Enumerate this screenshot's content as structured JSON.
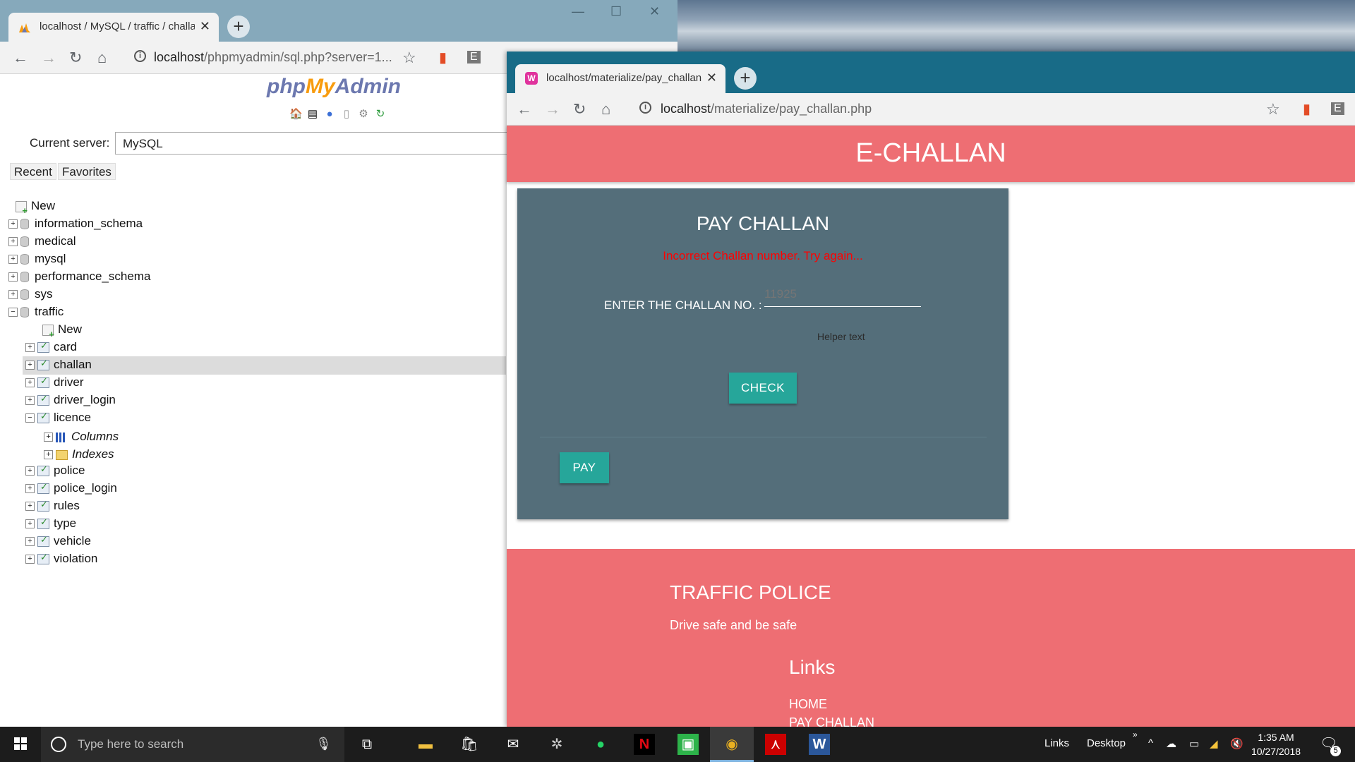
{
  "left_window": {
    "tab_title": "localhost / MySQL / traffic / challan",
    "url_host": "localhost",
    "url_path": "/phpmyadmin/sql.php?server=1...",
    "logo": {
      "php": "php",
      "my": "My",
      "admin": "Admin"
    },
    "current_server_label": "Current server:",
    "current_server_value": "MySQL",
    "recent_label": "Recent",
    "favorites_label": "Favorites",
    "tree": {
      "new": "New",
      "dbs": [
        "information_schema",
        "medical",
        "mysql",
        "performance_schema",
        "sys"
      ],
      "traffic": "traffic",
      "traffic_new": "New",
      "tables_a": [
        "card",
        "challan",
        "driver",
        "driver_login"
      ],
      "licence": "licence",
      "columns": "Columns",
      "indexes": "Indexes",
      "tables_b": [
        "police",
        "police_login",
        "rules",
        "type",
        "vehicle",
        "violation"
      ]
    }
  },
  "right_window": {
    "tab_title": "localhost/materialize/pay_challan.php",
    "url_host": "localhost",
    "url_path": "/materialize/pay_challan.php",
    "brand": "E-CHALLAN",
    "card": {
      "title": "PAY CHALLAN",
      "error": "Incorrect Challan number. Try again...",
      "label": "ENTER THE CHALLAN NO. :",
      "placeholder": "11925",
      "helper": "Helper text",
      "check_label": "CHECK",
      "pay_label": "PAY"
    },
    "footer": {
      "title": "TRAFFIC POLICE",
      "text": "Drive safe and be safe",
      "links_title": "Links",
      "links": [
        "HOME",
        "PAY CHALLAN"
      ]
    }
  },
  "taskbar": {
    "search_placeholder": "Type here to search",
    "links_label": "Links",
    "desktop_label": "Desktop",
    "time": "1:35 AM",
    "date": "10/27/2018",
    "notification_count": "5"
  },
  "colors": {
    "materialize_red": "#ee6e73",
    "card_bg": "#546e7a",
    "teal_button": "#26a69a",
    "left_tabbar": "#86a9bb",
    "right_tabbar": "#186b87"
  }
}
